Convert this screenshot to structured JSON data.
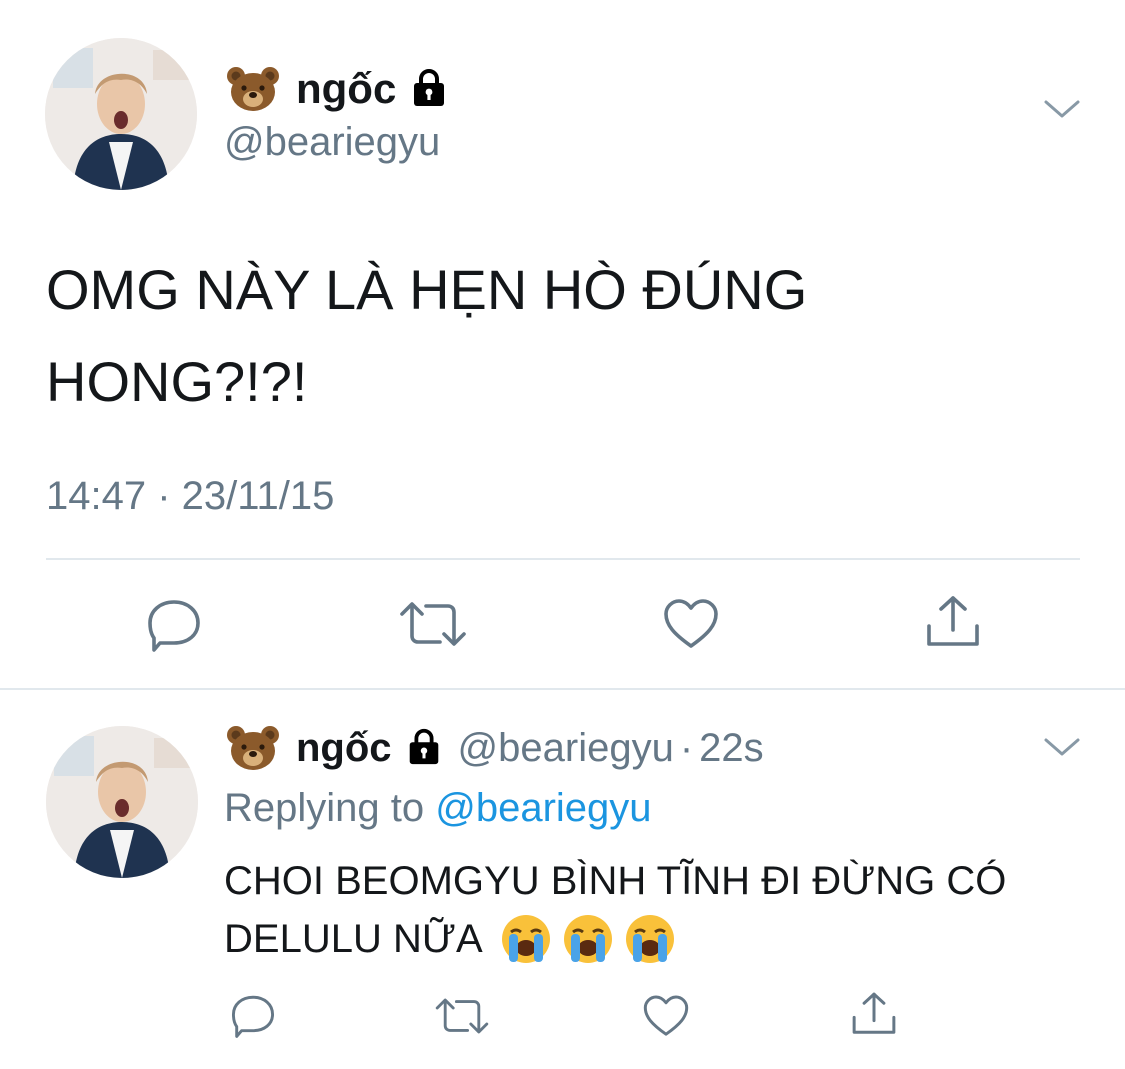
{
  "main_tweet": {
    "display_name": "ngốc",
    "handle": "@beariegyu",
    "text_line1": "OMG NÀY LÀ HẸN HÒ ĐÚNG",
    "text_line2": "HONG?!?!",
    "timestamp": "14:47 · 23/11/15",
    "name_emoji": "bear-face",
    "protected_icon": "lock-icon"
  },
  "reply_tweet": {
    "display_name": "ngốc",
    "handle": "@beariegyu",
    "time_sep": "·",
    "time_ago": "22s",
    "replying_to_label": "Replying to",
    "replying_to_handle": "@beariegyu",
    "text_line1": "CHOI BEOMGYU BÌNH TĨNH ĐI ĐỪNG CÓ",
    "text_line2": "DELULU NỮA",
    "trailing_emojis": [
      "loudly-crying-face",
      "loudly-crying-face",
      "loudly-crying-face"
    ]
  },
  "actions": [
    "reply-icon",
    "retweet-icon",
    "like-icon",
    "share-icon"
  ],
  "colors": {
    "text": "#14171a",
    "secondary": "#657786",
    "link": "#1b95e0",
    "icon": "#657786",
    "divider": "#e1e8ed"
  }
}
